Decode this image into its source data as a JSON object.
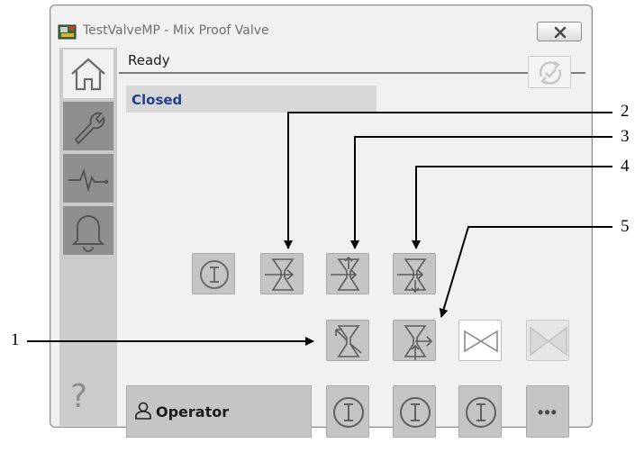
{
  "window": {
    "title": "TestValveMP - Mix Proof Valve"
  },
  "icons": {
    "app": "valve-app-icon",
    "close": "close-x-icon",
    "home": "home-icon",
    "maintenance": "wrench-icon",
    "trends": "pulse-icon",
    "alarms": "bell-icon",
    "help": "question-icon",
    "command_source": "refresh-check-icon",
    "operator": "person-icon"
  },
  "status": {
    "text": "Ready",
    "state": "Closed"
  },
  "user": {
    "label": "Operator"
  },
  "help": {
    "label": "?"
  },
  "more": {
    "label": "•••"
  },
  "callouts": [
    "1",
    "2",
    "3",
    "4",
    "5"
  ],
  "colors": {
    "state_text": "#24418f",
    "button_gray": "#c5c5c5",
    "nav_gray": "#8f8f8f"
  }
}
